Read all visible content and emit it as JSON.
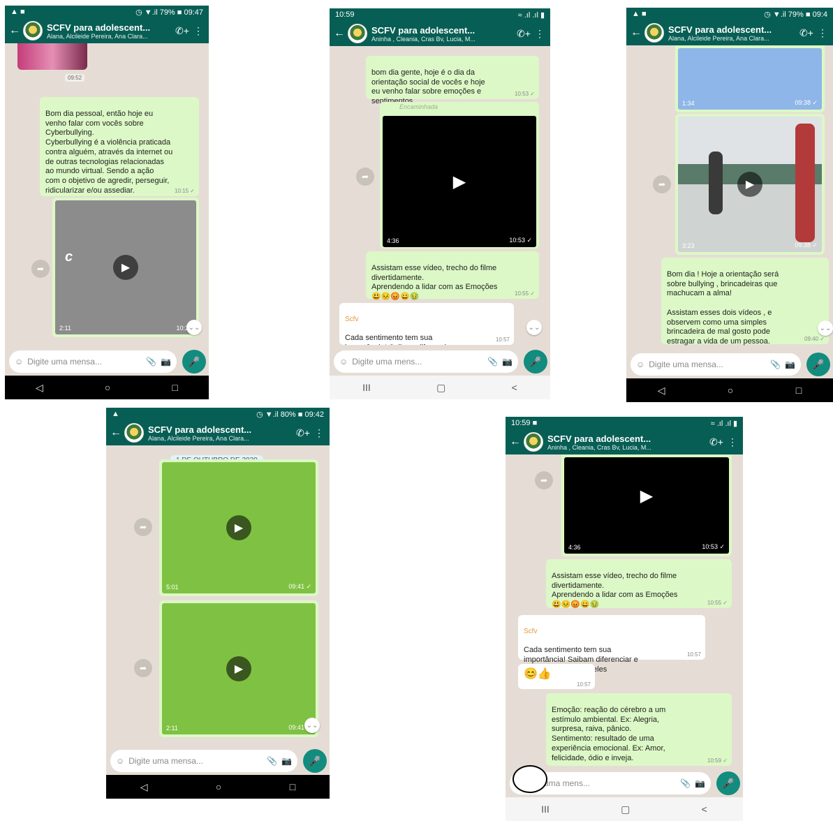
{
  "phones": [
    {
      "status": {
        "left": "▲ ■",
        "right": "◷ ▼.il 79% ■ 09:47"
      },
      "header": {
        "title": "SCFV para adolescent...",
        "subtitle": "Alana, Alcileide Pereira, Ana Clara..."
      },
      "messages": [
        {
          "time": "09:52"
        },
        {
          "text": "Bom dia pessoal, então hoje eu\nvenho falar com vocês sobre\nCyberbullying.\nCyberbullying é a violência praticada\ncontra alguém, através da internet ou\nde outras tecnologias relacionadas\nao mundo virtual. Sendo a ação\ncom o objetivo de agredir, perseguir,\nridicularizar e/ou assediar.",
          "time": "10:15 ✓"
        },
        {
          "duration": "2:11",
          "time": "10:20",
          "overlay": "c"
        }
      ],
      "composer": {
        "placeholder": "Digite uma mensa..."
      },
      "nav": [
        "◁",
        "○",
        "□"
      ]
    },
    {
      "status": {
        "left": "10:59",
        "right": "≈ .ıl .ıl ▮"
      },
      "header": {
        "title": "SCFV para adolescent...",
        "subtitle": "Aninha , Cleania, Cras Bv, Lucia, M..."
      },
      "messages": [
        {
          "text": "bom dia gente, hoje é o dia da\norientação social de vocês e hoje\neu venho falar sobre emoções e\nsentimentos.",
          "time": "10:53 ✓"
        },
        {
          "forwarded": "Encaminhada"
        },
        {
          "duration": "4:36",
          "time": "10:53 ✓"
        },
        {
          "text": "Assistam esse vídeo, trecho do filme\ndivertidamente.\nAprendendo a lidar com as Emoções\n😃😣😡😄🤢",
          "time": "10:55 ✓"
        },
        {
          "sender": "Scfv",
          "text": "Cada sentimento tem sua\nimportância! Saibam diferenciar e\nlidar com cada um deles",
          "time": "10:57"
        }
      ],
      "composer": {
        "placeholder": "Digite uma mens..."
      },
      "nav": [
        "III",
        "▢",
        "<"
      ]
    },
    {
      "status": {
        "left": "▲ ■",
        "right": "◷ ▼.il 79% ■ 09:4"
      },
      "header": {
        "title": "SCFV para adolescent...",
        "subtitle": "Alana, Alcileide Pereira, Ana Clara..."
      },
      "messages": [
        {
          "duration": "1:34",
          "time": "09:38 ✓"
        },
        {
          "duration": "3:23",
          "time": "09:38 ✓"
        },
        {
          "text": "Bom dia ! Hoje a orientação será\nsobre bullying , brincadeiras que\nmachucam a alma!\n\nAssistam esses dois vídeos , e\nobservem como uma simples\nbrincadeira de mal gosto pode\nestragar a vida de um pessoa.",
          "time": "09:40 ✓"
        }
      ],
      "composer": {
        "placeholder": "Digite uma mensa..."
      },
      "nav": [
        "◁",
        "○",
        "□"
      ]
    },
    {
      "status": {
        "left": "▲",
        "right": "◷ ▼.il 80% ■ 09:42"
      },
      "header": {
        "title": "SCFV para adolescent...",
        "subtitle": "Alana, Alcileide Pereira, Ana Clara..."
      },
      "date_chip": "1 DE OUTUBRO DE 2020",
      "messages": [
        {
          "duration": "5:01",
          "time": "09:41 ✓"
        },
        {
          "duration": "2:11",
          "time": "09:41 ✓"
        }
      ],
      "composer": {
        "placeholder": "Digite uma mensa..."
      },
      "nav": [
        "◁",
        "○",
        "□"
      ]
    },
    {
      "status": {
        "left": "10:59 ■",
        "right": "≈ .ıl .ıl ▮"
      },
      "header": {
        "title": "SCFV para adolescent...",
        "subtitle": "Aninha , Cleania, Cras Bv, Lucia, M..."
      },
      "messages": [
        {
          "duration": "4:36",
          "time": "10:53 ✓"
        },
        {
          "text": "Assistam esse vídeo, trecho do filme\ndivertidamente.\nAprendendo a lidar com as Emoções\n😃😣😡😄🤢",
          "time": "10:55 ✓"
        },
        {
          "sender": "Scfv",
          "text": "Cada sentimento tem sua\nimportância! Saibam diferenciar e\nlidar com cada um deles",
          "time": "10:57"
        },
        {
          "text": "😊👍",
          "time": "10:57"
        },
        {
          "text": "Emoção: reação do cérebro a um\nestímulo ambiental.  Ex: Alegria,\nsurpresa, raiva, pânico.\nSentimento: resultado de uma\nexperiência emocional.  Ex: Amor,\nfelicidade, ódio e inveja.",
          "time": "10:59 ✓"
        }
      ],
      "composer": {
        "placeholder": "gite uma mens..."
      },
      "nav": [
        "III",
        "▢",
        "<"
      ]
    }
  ],
  "icons": {
    "back": "←",
    "call": "✆+",
    "menu": "⋮",
    "emoji": "☺",
    "attach": "📎",
    "camera": "📷",
    "mic": "🎤",
    "play": "▶",
    "forward": "➦",
    "scroll_down": "⌄⌄",
    "video_cam": "■◂"
  },
  "colors": {
    "header": "#075e54",
    "outgoing": "#dcf8c6",
    "incoming": "#ffffff",
    "chat_bg": "#e5ddd5",
    "mic": "#128c7e"
  }
}
